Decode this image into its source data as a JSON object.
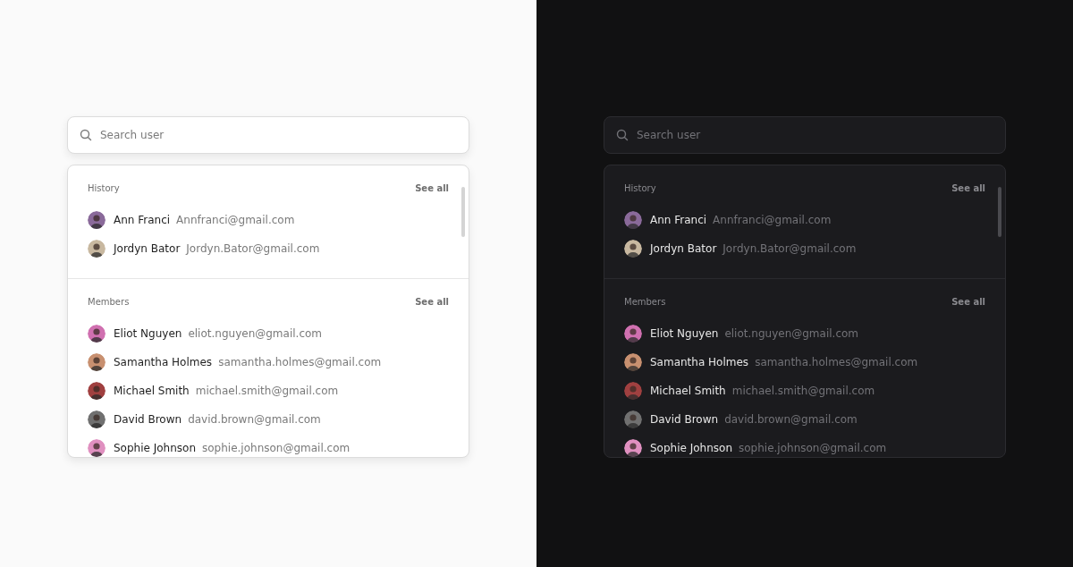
{
  "panels": [
    {
      "kind": "light",
      "search": {
        "placeholder": "Search user"
      },
      "sections": [
        {
          "title": "History",
          "action": "See all",
          "users": [
            {
              "name": "Ann Franci",
              "email": "Annfranci@gmail.com",
              "color": "#8a6a9a"
            },
            {
              "name": "Jordyn Bator",
              "email": "Jordyn.Bator@gmail.com",
              "color": "#c8b8a0"
            }
          ]
        },
        {
          "title": "Members",
          "action": "See all",
          "users": [
            {
              "name": "Eliot Nguyen",
              "email": "eliot.nguyen@gmail.com",
              "color": "#d070b0"
            },
            {
              "name": "Samantha Holmes",
              "email": "samantha.holmes@gmail.com",
              "color": "#c89070"
            },
            {
              "name": "Michael Smith",
              "email": "michael.smith@gmail.com",
              "color": "#a04040"
            },
            {
              "name": "David Brown",
              "email": "david.brown@gmail.com",
              "color": "#707070"
            },
            {
              "name": "Sophie Johnson",
              "email": "sophie.johnson@gmail.com",
              "color": "#e090c0"
            }
          ]
        }
      ]
    },
    {
      "kind": "dark",
      "search": {
        "placeholder": "Search user"
      },
      "sections": [
        {
          "title": "History",
          "action": "See all",
          "users": [
            {
              "name": "Ann Franci",
              "email": "Annfranci@gmail.com",
              "color": "#8a6a9a"
            },
            {
              "name": "Jordyn Bator",
              "email": "Jordyn.Bator@gmail.com",
              "color": "#c8b8a0"
            }
          ]
        },
        {
          "title": "Members",
          "action": "See all",
          "users": [
            {
              "name": "Eliot Nguyen",
              "email": "eliot.nguyen@gmail.com",
              "color": "#d070b0"
            },
            {
              "name": "Samantha Holmes",
              "email": "samantha.holmes@gmail.com",
              "color": "#c89070"
            },
            {
              "name": "Michael Smith",
              "email": "michael.smith@gmail.com",
              "color": "#a04040"
            },
            {
              "name": "David Brown",
              "email": "david.brown@gmail.com",
              "color": "#707070"
            },
            {
              "name": "Sophie Johnson",
              "email": "sophie.johnson@gmail.com",
              "color": "#e090c0"
            }
          ]
        }
      ]
    }
  ]
}
